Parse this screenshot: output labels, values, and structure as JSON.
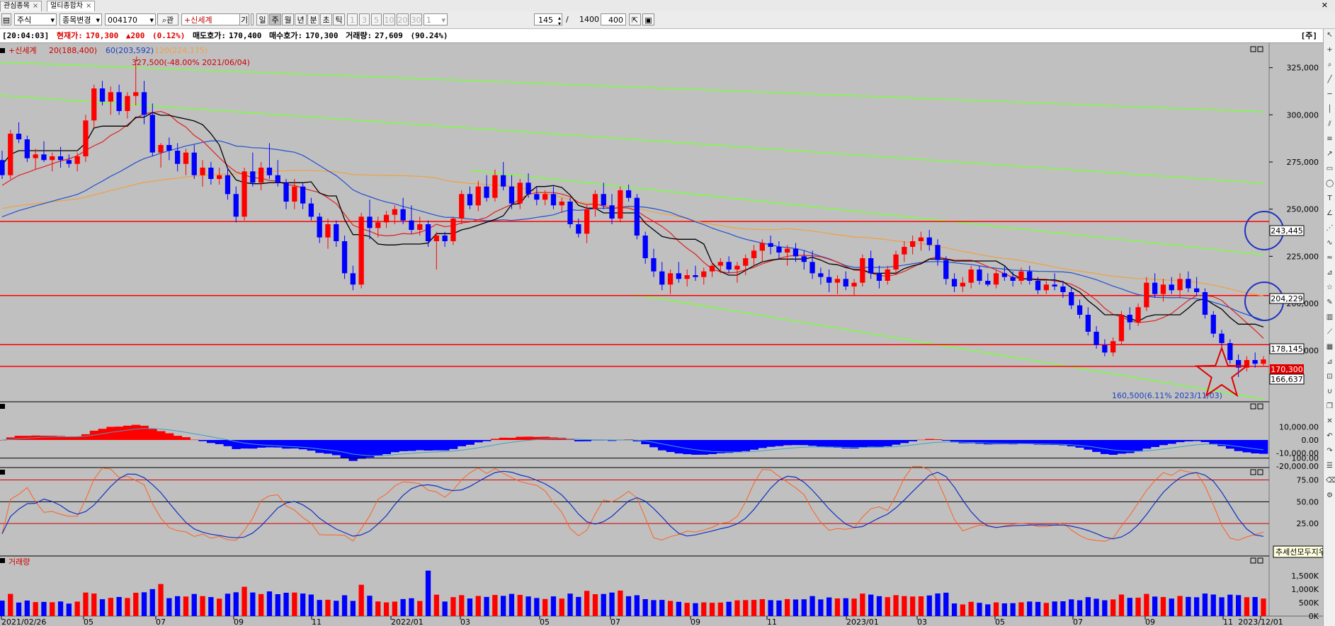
{
  "tabs": [
    {
      "label": "관심종목"
    },
    {
      "label": "멀티종합차"
    }
  ],
  "toolbar": {
    "market": "주식",
    "change_stock": "종목변경",
    "code": "004170",
    "search_label": "관",
    "stock_name": "+신세계",
    "ki_label": "기",
    "periods": [
      "일",
      "주",
      "월",
      "년",
      "분",
      "초",
      "틱"
    ],
    "selected_period": "주",
    "intervals": [
      "1",
      "3",
      "5",
      "10",
      "20",
      "30"
    ],
    "interval_value": "1",
    "count": "145",
    "total": "1400",
    "view": "400"
  },
  "info_bar": {
    "time": "[20:04:03]",
    "current_label": "현재가:",
    "current_value": "170,300",
    "change": "▲200",
    "change_pct": "(0.12%)",
    "ask_label": "매도호가:",
    "ask_value": "170,400",
    "bid_label": "매수호가:",
    "bid_value": "170,300",
    "volume_label": "거래량:",
    "volume_value": "27,609",
    "volume_pct": "(90.24%)",
    "right_tag": "[주]"
  },
  "colors": {
    "up": "#ff0000",
    "down": "#0000ff",
    "ma20": "#e02020",
    "ma60": "#2050d0",
    "ma120": "#f0a040",
    "trendline": "#7cff40",
    "hline": "#ff0000",
    "background": "#c0c0c0"
  },
  "chart_data": [
    {
      "type": "candlestick",
      "legend": [
        "+신세계",
        "20(188,400)",
        "60(203,592)",
        "120(224,175)"
      ],
      "high_annotation": "327,500(-48.00% 2021/06/04)",
      "low_annotation": "160,500(6.11% 2023/11/03)",
      "y_ticks": [
        "325,000",
        "300,000",
        "275,000",
        "250,000",
        "225,000",
        "200,000",
        "175,000"
      ],
      "ylim": [
        155000,
        335000
      ],
      "price_tags": [
        "243,445",
        "204,229",
        "178,145",
        "170,300",
        "166,637"
      ],
      "horizontal_lines": [
        243445,
        204229,
        178145,
        166637
      ],
      "x_labels": [
        "2021/02/26",
        "05",
        "07",
        "09",
        "11",
        "2022/01",
        "03",
        "05",
        "07",
        "09",
        "11",
        "2023/01",
        "03",
        "05",
        "07",
        "09",
        "11",
        "2023/12/01"
      ],
      "candles_ohlc": [
        [
          276000,
          281000,
          266000,
          268000
        ],
        [
          268000,
          292000,
          266000,
          290000
        ],
        [
          290000,
          296000,
          285000,
          287000
        ],
        [
          287000,
          289000,
          275000,
          277000
        ],
        [
          277000,
          282000,
          271000,
          279000
        ],
        [
          279000,
          286000,
          275000,
          276000
        ],
        [
          276000,
          280000,
          270000,
          278000
        ],
        [
          278000,
          283000,
          272000,
          276000
        ],
        [
          276000,
          279000,
          272000,
          274000
        ],
        [
          274000,
          280000,
          270000,
          278000
        ],
        [
          278000,
          300000,
          275000,
          297000
        ],
        [
          297000,
          316000,
          293000,
          314000
        ],
        [
          314000,
          318000,
          305000,
          307000
        ],
        [
          307000,
          315000,
          300000,
          312000
        ],
        [
          312000,
          316000,
          300000,
          302000
        ],
        [
          302000,
          312000,
          298000,
          310000
        ],
        [
          310000,
          327500,
          305000,
          312000
        ],
        [
          312000,
          318000,
          295000,
          300000
        ],
        [
          300000,
          306000,
          278000,
          280000
        ],
        [
          280000,
          285000,
          272000,
          284000
        ],
        [
          284000,
          288000,
          276000,
          281000
        ],
        [
          281000,
          285000,
          270000,
          274000
        ],
        [
          274000,
          282000,
          268000,
          280000
        ],
        [
          280000,
          284000,
          266000,
          268000
        ],
        [
          268000,
          276000,
          262000,
          272000
        ],
        [
          272000,
          275000,
          263000,
          266000
        ],
        [
          266000,
          272000,
          263000,
          268000
        ],
        [
          268000,
          272000,
          255000,
          258000
        ],
        [
          258000,
          262000,
          243000,
          246000
        ],
        [
          246000,
          272000,
          244000,
          270000
        ],
        [
          270000,
          280000,
          262000,
          264000
        ],
        [
          264000,
          275000,
          260000,
          272000
        ],
        [
          272000,
          285000,
          266000,
          268000
        ],
        [
          268000,
          276000,
          262000,
          264000
        ],
        [
          264000,
          266000,
          250000,
          254000
        ],
        [
          254000,
          266000,
          250000,
          262000
        ],
        [
          262000,
          264000,
          250000,
          253000
        ],
        [
          253000,
          256000,
          244000,
          246000
        ],
        [
          246000,
          248000,
          232000,
          235000
        ],
        [
          235000,
          245000,
          229000,
          242000
        ],
        [
          242000,
          244000,
          230000,
          233000
        ],
        [
          233000,
          236000,
          213000,
          216000
        ],
        [
          216000,
          220000,
          207000,
          210000
        ],
        [
          210000,
          248000,
          208000,
          246000
        ],
        [
          246000,
          255000,
          234000,
          240000
        ],
        [
          240000,
          246000,
          235000,
          243000
        ],
        [
          243000,
          249000,
          240000,
          247000
        ],
        [
          247000,
          252000,
          242000,
          250000
        ],
        [
          250000,
          256000,
          242000,
          244000
        ],
        [
          244000,
          252000,
          237000,
          239000
        ],
        [
          239000,
          246000,
          236000,
          242000
        ],
        [
          242000,
          244000,
          230000,
          233000
        ],
        [
          233000,
          238000,
          218000,
          236000
        ],
        [
          236000,
          238000,
          230000,
          233000
        ],
        [
          233000,
          246000,
          231000,
          245000
        ],
        [
          245000,
          260000,
          242000,
          258000
        ],
        [
          258000,
          262000,
          250000,
          252000
        ],
        [
          252000,
          265000,
          249000,
          262000
        ],
        [
          262000,
          268000,
          254000,
          256000
        ],
        [
          256000,
          271000,
          254000,
          268000
        ],
        [
          268000,
          275000,
          260000,
          262000
        ],
        [
          262000,
          268000,
          250000,
          253000
        ],
        [
          253000,
          266000,
          250000,
          264000
        ],
        [
          264000,
          269000,
          256000,
          258000
        ],
        [
          258000,
          262000,
          252000,
          255000
        ],
        [
          255000,
          260000,
          252000,
          258000
        ],
        [
          258000,
          262000,
          250000,
          252000
        ],
        [
          252000,
          256000,
          248000,
          254000
        ],
        [
          254000,
          256000,
          240000,
          242000
        ],
        [
          242000,
          245000,
          235000,
          237000
        ],
        [
          237000,
          252000,
          232000,
          250000
        ],
        [
          250000,
          260000,
          246000,
          258000
        ],
        [
          258000,
          264000,
          250000,
          252000
        ],
        [
          252000,
          258000,
          242000,
          245000
        ],
        [
          245000,
          262000,
          243000,
          260000
        ],
        [
          260000,
          263000,
          254000,
          256000
        ],
        [
          256000,
          258000,
          234000,
          236000
        ],
        [
          236000,
          238000,
          221000,
          224000
        ],
        [
          224000,
          229000,
          214000,
          217000
        ],
        [
          217000,
          222000,
          207000,
          210000
        ],
        [
          210000,
          218000,
          205000,
          216000
        ],
        [
          216000,
          222000,
          211000,
          213000
        ],
        [
          213000,
          218000,
          209000,
          215000
        ],
        [
          215000,
          220000,
          212000,
          214000
        ],
        [
          214000,
          219000,
          210000,
          217000
        ],
        [
          217000,
          222000,
          214000,
          220000
        ],
        [
          220000,
          224000,
          216000,
          222000
        ],
        [
          222000,
          225000,
          216000,
          218000
        ],
        [
          218000,
          222000,
          211000,
          220000
        ],
        [
          220000,
          226000,
          215000,
          224000
        ],
        [
          224000,
          231000,
          220000,
          228000
        ],
        [
          228000,
          234000,
          222000,
          232000
        ],
        [
          232000,
          236000,
          226000,
          230000
        ],
        [
          230000,
          233000,
          224000,
          227000
        ],
        [
          227000,
          231000,
          220000,
          229000
        ],
        [
          229000,
          232000,
          222000,
          225000
        ],
        [
          225000,
          228000,
          218000,
          222000
        ],
        [
          222000,
          228000,
          213000,
          216000
        ],
        [
          216000,
          219000,
          210000,
          214000
        ],
        [
          214000,
          218000,
          206000,
          211000
        ],
        [
          211000,
          215000,
          205000,
          213000
        ],
        [
          213000,
          217000,
          207000,
          209000
        ],
        [
          209000,
          213000,
          204000,
          211000
        ],
        [
          211000,
          226000,
          209000,
          224000
        ],
        [
          224000,
          228000,
          213000,
          216000
        ],
        [
          216000,
          220000,
          208000,
          212000
        ],
        [
          212000,
          220000,
          210000,
          218000
        ],
        [
          218000,
          228000,
          215000,
          226000
        ],
        [
          226000,
          233000,
          222000,
          230000
        ],
        [
          230000,
          236000,
          226000,
          233000
        ],
        [
          233000,
          238000,
          228000,
          235000
        ],
        [
          235000,
          239000,
          228000,
          231000
        ],
        [
          231000,
          234000,
          220000,
          223000
        ],
        [
          223000,
          225000,
          210000,
          213000
        ],
        [
          213000,
          216000,
          206000,
          209000
        ],
        [
          209000,
          214000,
          206000,
          211000
        ],
        [
          211000,
          220000,
          208000,
          218000
        ],
        [
          218000,
          220000,
          210000,
          212000
        ],
        [
          212000,
          216000,
          209000,
          210000
        ],
        [
          210000,
          218000,
          208000,
          216000
        ],
        [
          216000,
          220000,
          212000,
          214000
        ],
        [
          214000,
          217000,
          209000,
          212000
        ],
        [
          212000,
          219000,
          210000,
          217000
        ],
        [
          217000,
          220000,
          210000,
          212000
        ],
        [
          212000,
          214000,
          205000,
          207000
        ],
        [
          207000,
          212000,
          205000,
          210000
        ],
        [
          210000,
          216000,
          207000,
          209000
        ],
        [
          209000,
          212000,
          203000,
          206000
        ],
        [
          206000,
          209000,
          197000,
          199000
        ],
        [
          199000,
          202000,
          192000,
          194000
        ],
        [
          194000,
          198000,
          183000,
          185000
        ],
        [
          185000,
          188000,
          176000,
          178000
        ],
        [
          178000,
          181000,
          172000,
          174000
        ],
        [
          174000,
          182000,
          172000,
          180000
        ],
        [
          180000,
          196000,
          178000,
          194000
        ],
        [
          194000,
          198000,
          186000,
          190000
        ],
        [
          190000,
          200000,
          188000,
          198000
        ],
        [
          198000,
          214000,
          196000,
          211000
        ],
        [
          211000,
          216000,
          203000,
          205000
        ],
        [
          205000,
          213000,
          201000,
          210000
        ],
        [
          210000,
          214000,
          205000,
          207000
        ],
        [
          207000,
          216000,
          203000,
          213000
        ],
        [
          213000,
          217000,
          206000,
          208000
        ],
        [
          208000,
          214000,
          204000,
          206000
        ],
        [
          206000,
          208000,
          192000,
          194000
        ],
        [
          194000,
          196000,
          182000,
          184000
        ],
        [
          184000,
          186000,
          177000,
          179000
        ],
        [
          179000,
          181000,
          168000,
          170000
        ],
        [
          170000,
          173000,
          161000,
          166000
        ],
        [
          166000,
          172000,
          164000,
          170000
        ],
        [
          170000,
          174000,
          166000,
          168000
        ],
        [
          168000,
          172000,
          167000,
          170300
        ]
      ]
    },
    {
      "type": "bar",
      "name": "macd_oscillator",
      "y_ticks": [
        "10,000.00",
        "0.00",
        "-10,000.00",
        "-20,000.00"
      ],
      "ylim": [
        -27000,
        17000
      ]
    },
    {
      "type": "line",
      "name": "stochastic",
      "y_ticks": [
        "100.00",
        "75.00",
        "50.00",
        "25.00"
      ],
      "ylim": [
        0,
        100
      ],
      "tooltip": "추세선모두지우"
    },
    {
      "type": "bar",
      "name": "volume",
      "legend": [
        "거래량"
      ],
      "y_ticks": [
        "1,500K",
        "1,000K",
        "500K",
        "0K"
      ],
      "ylim": [
        0,
        1850000
      ]
    }
  ]
}
